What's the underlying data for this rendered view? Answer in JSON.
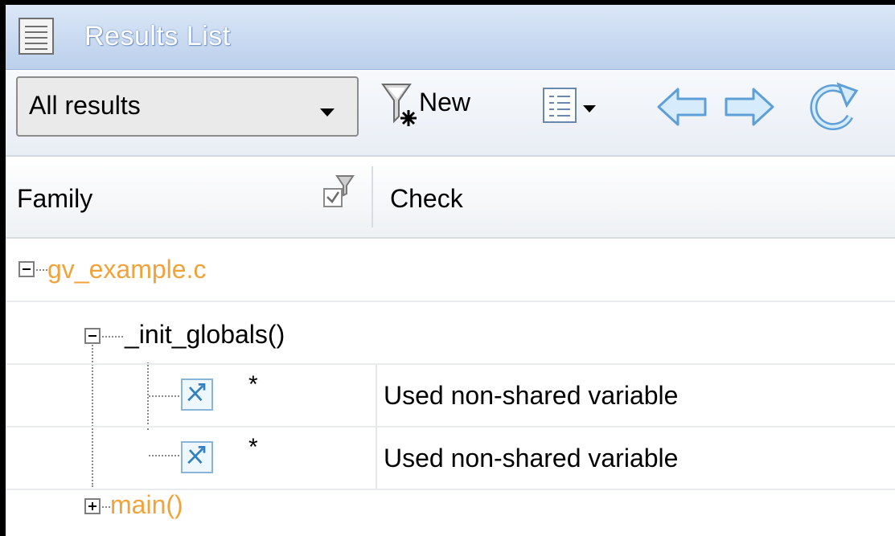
{
  "window": {
    "title": "Results List"
  },
  "toolbar": {
    "filter_value": "All results",
    "new_label": "New"
  },
  "columns": {
    "family": "Family",
    "check": "Check"
  },
  "tree": {
    "file": "gv_example.c",
    "func1": "_init_globals()",
    "results": [
      {
        "star": "*",
        "check": "Used non-shared variable"
      },
      {
        "star": "*",
        "check": "Used non-shared variable"
      }
    ],
    "func2": "main()"
  },
  "colors": {
    "file_text": "#f0a33a",
    "title_bar": "#c9daf1",
    "badge_icon": "#2f7fc1"
  }
}
